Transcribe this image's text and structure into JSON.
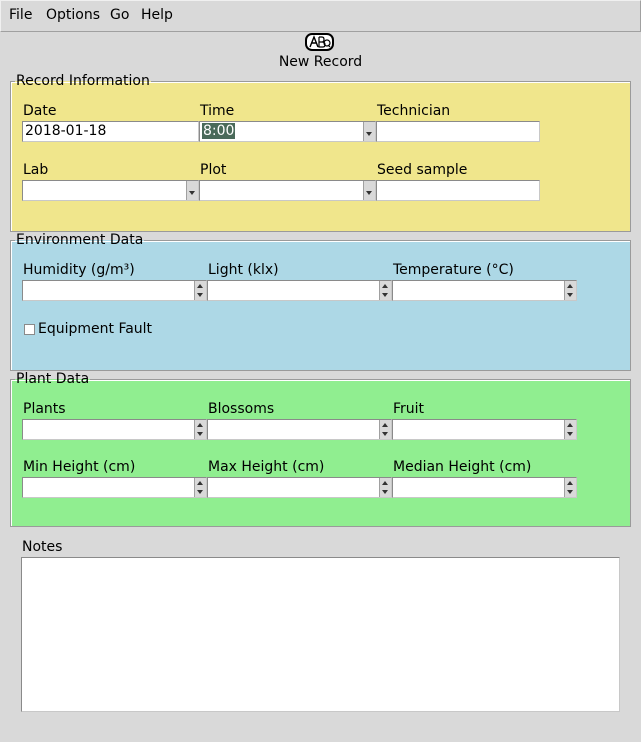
{
  "menu": [
    "File",
    "Options",
    "Go",
    "Help"
  ],
  "logo_text": "ABQ",
  "title": "New Record",
  "record_info": {
    "legend": "Record Information",
    "date_label": "Date",
    "date_value": "2018-01-18",
    "time_label": "Time",
    "time_value": "8:00",
    "technician_label": "Technician",
    "technician_value": "",
    "lab_label": "Lab",
    "lab_value": "",
    "plot_label": "Plot",
    "plot_value": "",
    "seed_label": "Seed sample",
    "seed_value": ""
  },
  "environment": {
    "legend": "Environment Data",
    "humidity_label": "Humidity (g/m³)",
    "light_label": "Light (klx)",
    "temperature_label": "Temperature (°C)",
    "equipment_fault_label": "Equipment Fault",
    "equipment_fault_checked": false
  },
  "plant": {
    "legend": "Plant Data",
    "plants_label": "Plants",
    "blossoms_label": "Blossoms",
    "fruit_label": "Fruit",
    "min_height_label": "Min Height (cm)",
    "max_height_label": "Max Height (cm)",
    "median_height_label": "Median Height (cm)"
  },
  "notes": {
    "label": "Notes",
    "value": ""
  },
  "colors": {
    "record_bg": "#f0e68c",
    "environment_bg": "#add8e6",
    "plant_bg": "#90ee90",
    "window_bg": "#d9d9d9"
  }
}
